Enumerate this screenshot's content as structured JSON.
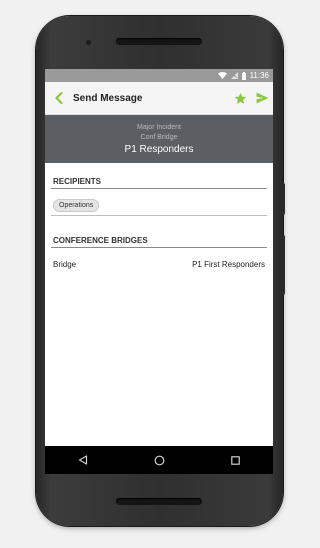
{
  "status_bar": {
    "time": "11:36"
  },
  "toolbar": {
    "title": "Send Message"
  },
  "header": {
    "line1": "Major Incident",
    "line2": "Conf Bridge",
    "line3": "P1 Responders"
  },
  "recipients": {
    "title": "RECIPIENTS",
    "chips": [
      "Operations"
    ]
  },
  "conference": {
    "title": "CONFERENCE BRIDGES",
    "row_label": "Bridge",
    "row_value": "P1 First Responders"
  },
  "colors": {
    "accent": "#8dc63f",
    "header_bg": "#5b5f63",
    "status_bg": "#9a9a9a"
  },
  "icons": [
    "back-arrow-icon",
    "star-icon",
    "send-icon",
    "wifi-icon",
    "signal-icon",
    "battery-icon",
    "nav-back-icon",
    "nav-home-icon",
    "nav-recents-icon"
  ]
}
